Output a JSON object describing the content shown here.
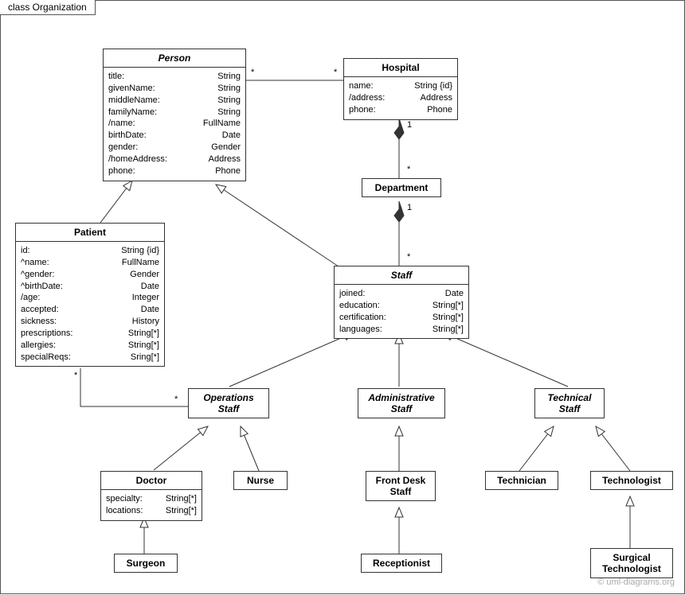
{
  "frame_title": "class Organization",
  "watermark": "© uml-diagrams.org",
  "classes": {
    "person": {
      "name": "Person",
      "attrs": [
        {
          "n": "title:",
          "t": "String"
        },
        {
          "n": "givenName:",
          "t": "String"
        },
        {
          "n": "middleName:",
          "t": "String"
        },
        {
          "n": "familyName:",
          "t": "String"
        },
        {
          "n": "/name:",
          "t": "FullName"
        },
        {
          "n": "birthDate:",
          "t": "Date"
        },
        {
          "n": "gender:",
          "t": "Gender"
        },
        {
          "n": "/homeAddress:",
          "t": "Address"
        },
        {
          "n": "phone:",
          "t": "Phone"
        }
      ]
    },
    "hospital": {
      "name": "Hospital",
      "attrs": [
        {
          "n": "name:",
          "t": "String {id}"
        },
        {
          "n": "/address:",
          "t": "Address"
        },
        {
          "n": "phone:",
          "t": "Phone"
        }
      ]
    },
    "department": {
      "name": "Department"
    },
    "patient": {
      "name": "Patient",
      "attrs": [
        {
          "n": "id:",
          "t": "String {id}"
        },
        {
          "n": "^name:",
          "t": "FullName"
        },
        {
          "n": "^gender:",
          "t": "Gender"
        },
        {
          "n": "^birthDate:",
          "t": "Date"
        },
        {
          "n": "/age:",
          "t": "Integer"
        },
        {
          "n": "accepted:",
          "t": "Date"
        },
        {
          "n": "sickness:",
          "t": "History"
        },
        {
          "n": "prescriptions:",
          "t": "String[*]"
        },
        {
          "n": "allergies:",
          "t": "String[*]"
        },
        {
          "n": "specialReqs:",
          "t": "Sring[*]"
        }
      ]
    },
    "staff": {
      "name": "Staff",
      "attrs": [
        {
          "n": "joined:",
          "t": "Date"
        },
        {
          "n": "education:",
          "t": "String[*]"
        },
        {
          "n": "certification:",
          "t": "String[*]"
        },
        {
          "n": "languages:",
          "t": "String[*]"
        }
      ]
    },
    "opsstaff": {
      "name": "Operations\nStaff"
    },
    "adminstaff": {
      "name": "Administrative\nStaff"
    },
    "techstaff": {
      "name": "Technical\nStaff"
    },
    "doctor": {
      "name": "Doctor",
      "attrs": [
        {
          "n": "specialty:",
          "t": "String[*]"
        },
        {
          "n": "locations:",
          "t": "String[*]"
        }
      ]
    },
    "nurse": {
      "name": "Nurse"
    },
    "frontdesk": {
      "name": "Front Desk\nStaff"
    },
    "technician": {
      "name": "Technician"
    },
    "technologist": {
      "name": "Technologist"
    },
    "surgeon": {
      "name": "Surgeon"
    },
    "receptionist": {
      "name": "Receptionist"
    },
    "surgtech": {
      "name": "Surgical\nTechnologist"
    }
  },
  "multiplicities": {
    "person_hospital_left": "*",
    "person_hospital_right": "*",
    "hospital_dept_top": "1",
    "hospital_dept_bottom": "*",
    "dept_staff_top": "1",
    "dept_staff_bottom": "*",
    "patient_ops_left": "*",
    "patient_ops_right": "*"
  }
}
